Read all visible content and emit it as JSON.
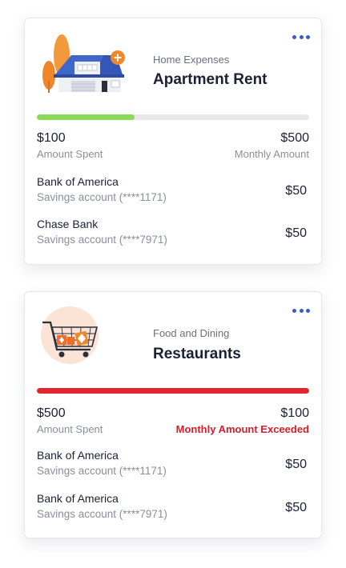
{
  "cards": [
    {
      "category": "Home Expenses",
      "title": "Apartment Rent",
      "progress": 0.36,
      "bar_color": "#8bd85a",
      "spent_value": "$100",
      "spent_label": "Amount Spent",
      "monthly_value": "$500",
      "monthly_label": "Monthly Amount",
      "accounts": [
        {
          "bank": "Bank of America",
          "type": "Savings account (****1171)",
          "amount": "$50"
        },
        {
          "bank": "Chase Bank",
          "type": "Savings account (****7971)",
          "amount": "$50"
        }
      ]
    },
    {
      "category": "Food and Dining",
      "title": "Restaurants",
      "progress": 1.0,
      "bar_color": "#e0272f",
      "spent_value": "$500",
      "spent_label": "Amount Spent",
      "monthly_value": "$100",
      "monthly_label": "Monthly Amount Exceeded",
      "accounts": [
        {
          "bank": "Bank of America",
          "type": "Savings account (****1171)",
          "amount": "$50"
        },
        {
          "bank": "Bank of America",
          "type": "Savings account (****7971)",
          "amount": "$50"
        }
      ]
    }
  ],
  "icons": {
    "menu": "more-horizontal-icon",
    "card1": "house-with-trees-icon",
    "card2": "shopping-cart-icon"
  },
  "colors": {
    "accent": "#3b5cc6",
    "exceeded": "#d0212e",
    "orange": "#f0882a"
  }
}
